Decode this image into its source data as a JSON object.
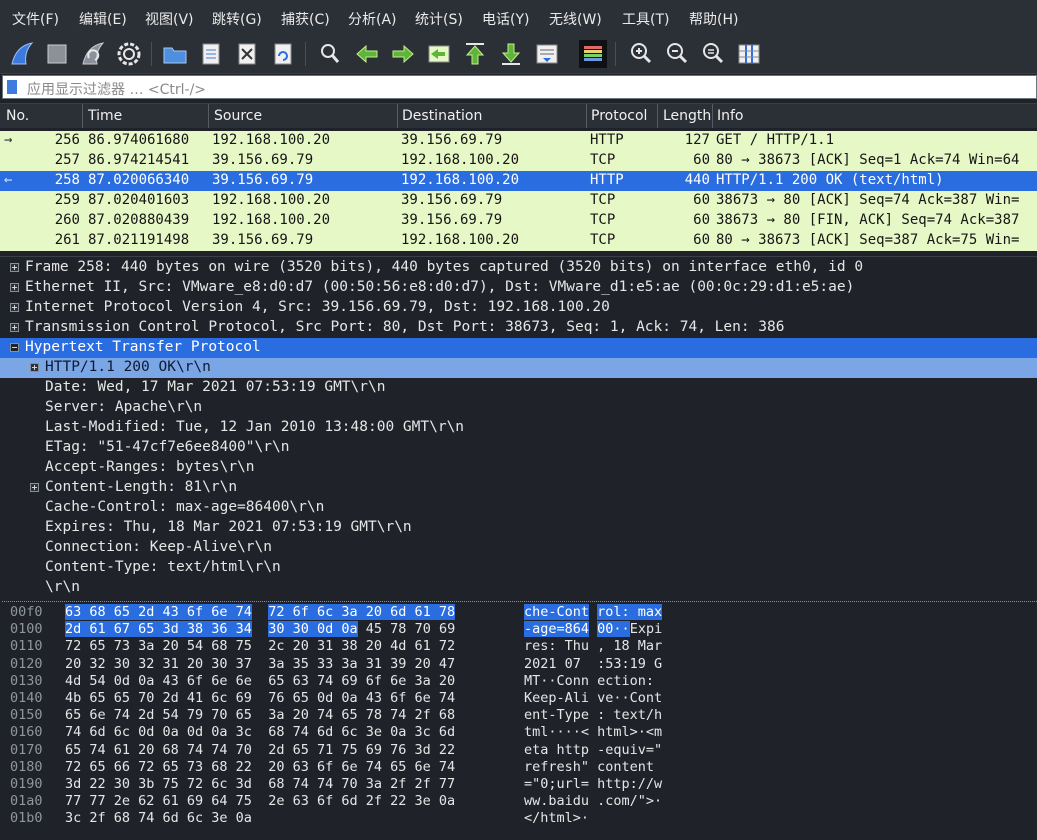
{
  "menu": [
    "文件(F)",
    "编辑(E)",
    "视图(V)",
    "跳转(G)",
    "捕获(C)",
    "分析(A)",
    "统计(S)",
    "电话(Y)",
    "无线(W)",
    "工具(T)",
    "帮助(H)"
  ],
  "toolbar": {
    "icons": [
      "shark-fin-start-icon",
      "stop-square-icon",
      "restart-fin-icon",
      "gear-options-icon",
      "folder-open-icon",
      "file-icon",
      "file-close-icon",
      "reload-icon",
      "search-icon",
      "arrow-left-icon",
      "arrow-right-icon",
      "go-to-packet-icon",
      "arrow-top-icon",
      "arrow-bottom-icon",
      "autoscroll-icon",
      "colorize-icon",
      "zoom-in-icon",
      "zoom-out-icon",
      "zoom-normal-icon",
      "resize-columns-icon"
    ]
  },
  "filter": {
    "placeholder": "应用显示过滤器 … <Ctrl-/>"
  },
  "packet_list": {
    "columns": [
      "No.",
      "Time",
      "Source",
      "Destination",
      "Protocol",
      "Length",
      "Info"
    ],
    "rows": [
      {
        "no": "256",
        "time": "86.974061680",
        "src": "192.168.100.20",
        "dst": "39.156.69.79",
        "proto": "HTTP",
        "len": "127",
        "info": "GET / HTTP/1.1",
        "selected": false
      },
      {
        "no": "257",
        "time": "86.974214541",
        "src": "39.156.69.79",
        "dst": "192.168.100.20",
        "proto": "TCP",
        "len": "60",
        "info": "80 → 38673 [ACK] Seq=1 Ack=74 Win=64",
        "selected": false
      },
      {
        "no": "258",
        "time": "87.020066340",
        "src": "39.156.69.79",
        "dst": "192.168.100.20",
        "proto": "HTTP",
        "len": "440",
        "info": "HTTP/1.1 200 OK  (text/html)",
        "selected": true
      },
      {
        "no": "259",
        "time": "87.020401603",
        "src": "192.168.100.20",
        "dst": "39.156.69.79",
        "proto": "TCP",
        "len": "60",
        "info": "38673 → 80 [ACK] Seq=74 Ack=387 Win=",
        "selected": false
      },
      {
        "no": "260",
        "time": "87.020880439",
        "src": "192.168.100.20",
        "dst": "39.156.69.79",
        "proto": "TCP",
        "len": "60",
        "info": "38673 → 80 [FIN, ACK] Seq=74 Ack=387",
        "selected": false
      },
      {
        "no": "261",
        "time": "87.021191498",
        "src": "39.156.69.79",
        "dst": "192.168.100.20",
        "proto": "TCP",
        "len": "60",
        "info": "80 → 38673 [ACK] Seq=387 Ack=75 Win=",
        "selected": false
      }
    ]
  },
  "details": [
    {
      "text": "Frame 258: 440 bytes on wire (3520 bits), 440 bytes captured (3520 bits) on interface eth0, id 0",
      "expander": "plus",
      "level": 0,
      "state": "normal"
    },
    {
      "text": "Ethernet II, Src: VMware_e8:d0:d7 (00:50:56:e8:d0:d7), Dst: VMware_d1:e5:ae (00:0c:29:d1:e5:ae)",
      "expander": "plus",
      "level": 0,
      "state": "normal"
    },
    {
      "text": "Internet Protocol Version 4, Src: 39.156.69.79, Dst: 192.168.100.20",
      "expander": "plus",
      "level": 0,
      "state": "normal"
    },
    {
      "text": "Transmission Control Protocol, Src Port: 80, Dst Port: 38673, Seq: 1, Ack: 74, Len: 386",
      "expander": "plus",
      "level": 0,
      "state": "normal"
    },
    {
      "text": "Hypertext Transfer Protocol",
      "expander": "minus",
      "level": 0,
      "state": "selected"
    },
    {
      "text": "HTTP/1.1 200 OK\\r\\n",
      "expander": "plus",
      "level": 1,
      "state": "highlight"
    },
    {
      "text": "Date: Wed, 17 Mar 2021 07:53:19 GMT\\r\\n",
      "expander": "none",
      "level": 1,
      "state": "normal"
    },
    {
      "text": "Server: Apache\\r\\n",
      "expander": "none",
      "level": 1,
      "state": "normal"
    },
    {
      "text": "Last-Modified: Tue, 12 Jan 2010 13:48:00 GMT\\r\\n",
      "expander": "none",
      "level": 1,
      "state": "normal"
    },
    {
      "text": "ETag: \"51-47cf7e6ee8400\"\\r\\n",
      "expander": "none",
      "level": 1,
      "state": "normal"
    },
    {
      "text": "Accept-Ranges: bytes\\r\\n",
      "expander": "none",
      "level": 1,
      "state": "normal"
    },
    {
      "text": "Content-Length: 81\\r\\n",
      "expander": "plus",
      "level": 1,
      "state": "normal"
    },
    {
      "text": "Cache-Control: max-age=86400\\r\\n",
      "expander": "none",
      "level": 1,
      "state": "normal"
    },
    {
      "text": "Expires: Thu, 18 Mar 2021 07:53:19 GMT\\r\\n",
      "expander": "none",
      "level": 1,
      "state": "normal"
    },
    {
      "text": "Connection: Keep-Alive\\r\\n",
      "expander": "none",
      "level": 1,
      "state": "normal"
    },
    {
      "text": "Content-Type: text/html\\r\\n",
      "expander": "none",
      "level": 1,
      "state": "normal"
    },
    {
      "text": "\\r\\n",
      "expander": "none",
      "level": 1,
      "state": "normal"
    }
  ],
  "hex": [
    {
      "off": "00f0",
      "h1": "63 68 65 2d 43 6f 6e 74",
      "h2": "72 6f 6c 3a 20 6d 61 78",
      "a1": "che-Cont",
      "a2": "rol: max",
      "sel": "all"
    },
    {
      "off": "0100",
      "h1": "2d 61 67 65 3d 38 36 34",
      "h2": "30 30 0d 0a",
      "h2b": "45 78 70 69",
      "a1": "-age=864",
      "a2": "00··",
      "a2b": "Expi",
      "sel": "partial"
    },
    {
      "off": "0110",
      "h1": "72 65 73 3a 20 54 68 75",
      "h2": "2c 20 31 38 20 4d 61 72",
      "a1": "res: Thu",
      "a2": ", 18 Mar",
      "sel": "none"
    },
    {
      "off": "0120",
      "h1": "20 32 30 32 31 20 30 37",
      "h2": "3a 35 33 3a 31 39 20 47",
      "a1": " 2021 07",
      "a2": ":53:19 G",
      "sel": "none"
    },
    {
      "off": "0130",
      "h1": "4d 54 0d 0a 43 6f 6e 6e",
      "h2": "65 63 74 69 6f 6e 3a 20",
      "a1": "MT··Conn",
      "a2": "ection: ",
      "sel": "none"
    },
    {
      "off": "0140",
      "h1": "4b 65 65 70 2d 41 6c 69",
      "h2": "76 65 0d 0a 43 6f 6e 74",
      "a1": "Keep-Ali",
      "a2": "ve··Cont",
      "sel": "none"
    },
    {
      "off": "0150",
      "h1": "65 6e 74 2d 54 79 70 65",
      "h2": "3a 20 74 65 78 74 2f 68",
      "a1": "ent-Type",
      "a2": ": text/h",
      "sel": "none"
    },
    {
      "off": "0160",
      "h1": "74 6d 6c 0d 0a 0d 0a 3c",
      "h2": "68 74 6d 6c 3e 0a 3c 6d",
      "a1": "tml····<",
      "a2": "html>·<m",
      "sel": "none"
    },
    {
      "off": "0170",
      "h1": "65 74 61 20 68 74 74 70",
      "h2": "2d 65 71 75 69 76 3d 22",
      "a1": "eta http",
      "a2": "-equiv=\"",
      "sel": "none"
    },
    {
      "off": "0180",
      "h1": "72 65 66 72 65 73 68 22",
      "h2": "20 63 6f 6e 74 65 6e 74",
      "a1": "refresh\"",
      "a2": " content",
      "sel": "none"
    },
    {
      "off": "0190",
      "h1": "3d 22 30 3b 75 72 6c 3d",
      "h2": "68 74 74 70 3a 2f 2f 77",
      "a1": "=\"0;url=",
      "a2": "http://w",
      "sel": "none"
    },
    {
      "off": "01a0",
      "h1": "77 77 2e 62 61 69 64 75",
      "h2": "2e 63 6f 6d 2f 22 3e 0a",
      "a1": "ww.baidu",
      "a2": ".com/\">·",
      "sel": "none"
    },
    {
      "off": "01b0",
      "h1": "3c 2f 68 74 6d 6c 3e 0a",
      "h2": "",
      "a1": "</html>·",
      "a2": "",
      "sel": "none"
    }
  ],
  "colors": {
    "selection": "#2a6de0",
    "row_bg": "#e7f8c7",
    "highlight": "#7aa6e6",
    "panel_bg": "#1f2329"
  }
}
